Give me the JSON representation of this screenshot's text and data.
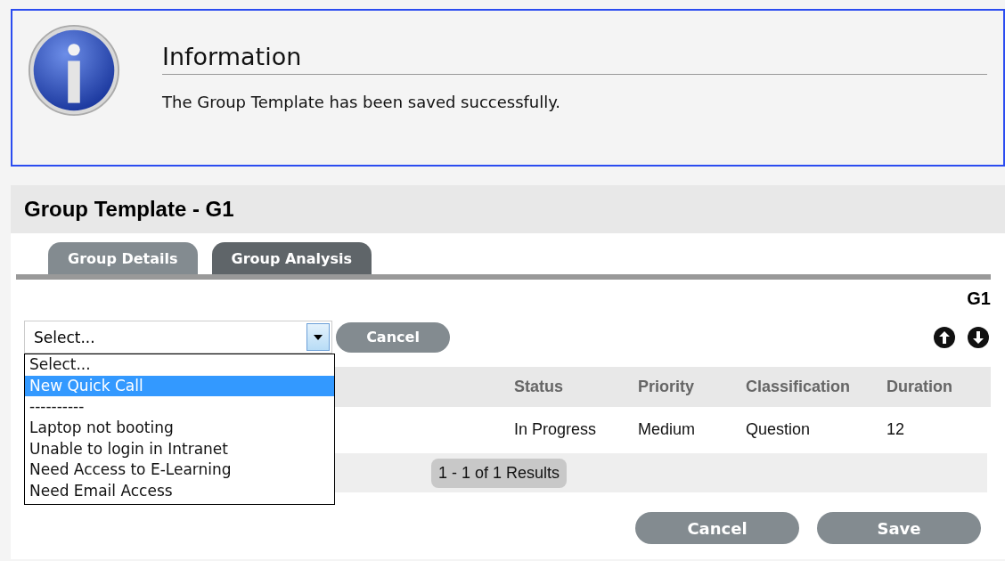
{
  "info": {
    "title": "Information",
    "message": "The Group Template has been saved successfully."
  },
  "panel": {
    "title": "Group Template - G1",
    "tabs": [
      {
        "label": "Group Details",
        "selected": false
      },
      {
        "label": "Group Analysis",
        "selected": true
      }
    ],
    "reference": "G1",
    "select": {
      "value": "Select...",
      "expanded": true,
      "options": [
        {
          "label": "Select...",
          "highlighted": false
        },
        {
          "label": "New Quick Call",
          "highlighted": true
        },
        {
          "label": "----------",
          "highlighted": false
        },
        {
          "label": "Laptop not booting",
          "highlighted": false
        },
        {
          "label": "Unable to login in Intranet",
          "highlighted": false
        },
        {
          "label": "Need Access to E-Learning",
          "highlighted": false
        },
        {
          "label": "Need Email Access",
          "highlighted": false
        }
      ]
    },
    "cancel_inline": "Cancel",
    "table": {
      "columns": [
        "Status",
        "Priority",
        "Classification",
        "Duration"
      ],
      "rows": [
        [
          "In Progress",
          "Medium",
          "Question",
          "12"
        ]
      ]
    },
    "pagination": "1 - 1 of 1 Results",
    "buttons": [
      "Cancel",
      "Save"
    ]
  }
}
